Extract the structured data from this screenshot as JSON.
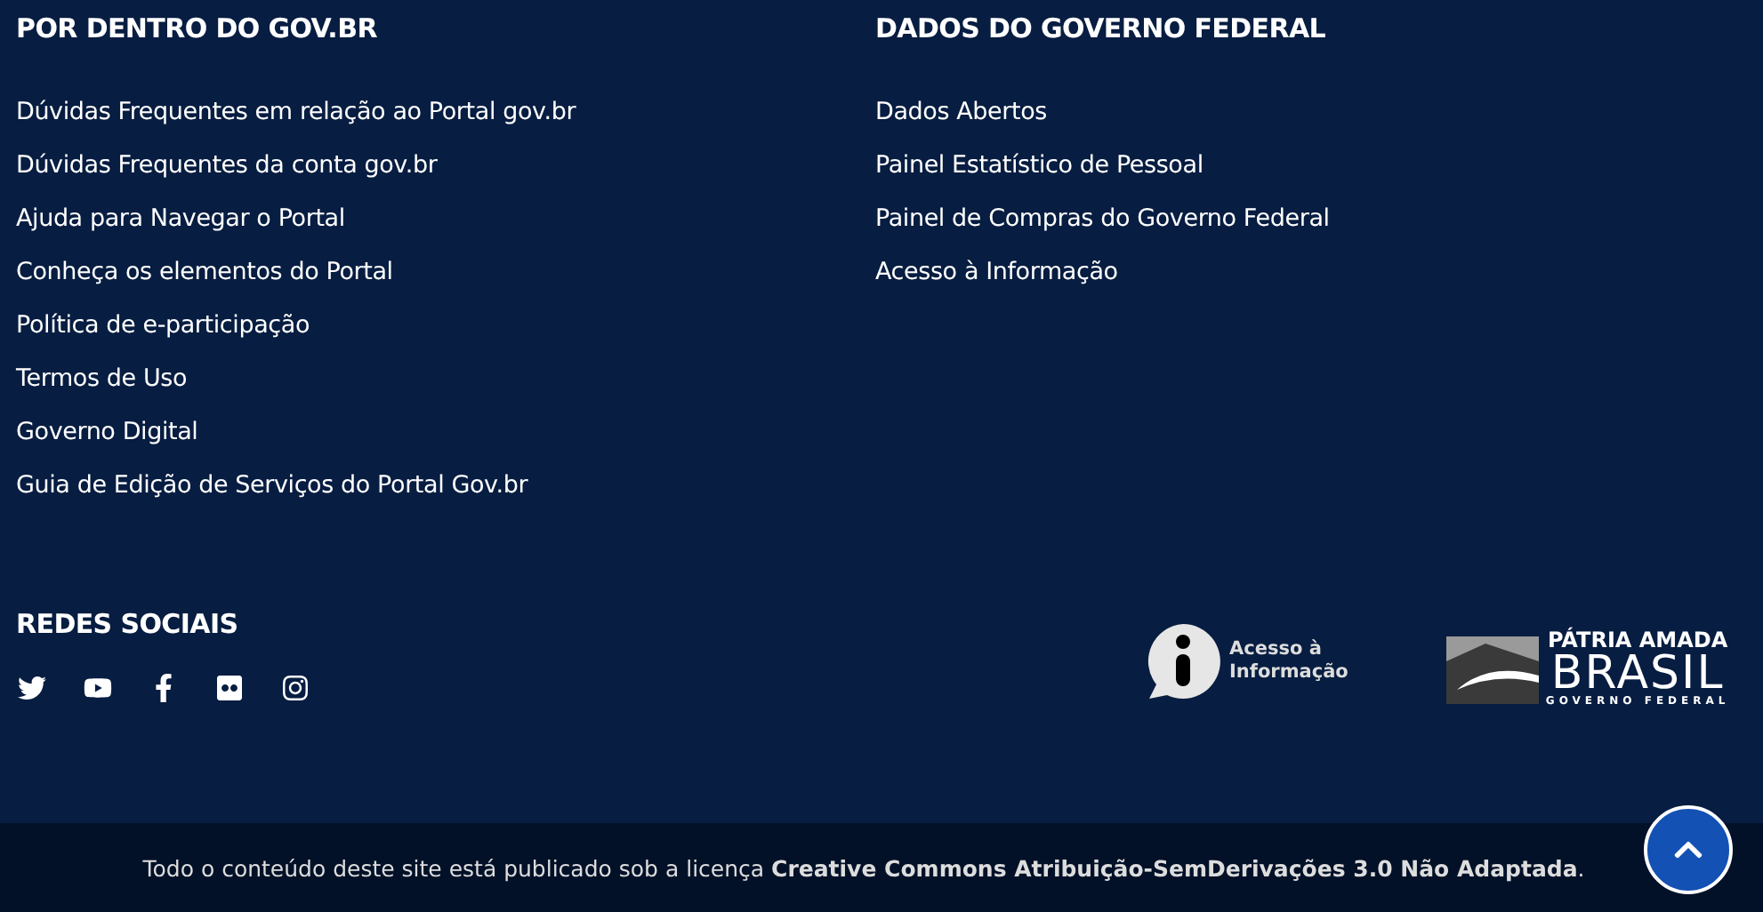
{
  "columns": [
    {
      "title": "POR DENTRO DO GOV.BR",
      "links": [
        "Dúvidas Frequentes em relação ao Portal gov.br",
        "Dúvidas Frequentes da conta gov.br",
        "Ajuda para Navegar o Portal",
        "Conheça os elementos do Portal",
        "Política de e-participação",
        "Termos de Uso",
        "Governo Digital",
        "Guia de Edição de Serviços do Portal Gov.br"
      ]
    },
    {
      "title": "DADOS DO GOVERNO FEDERAL",
      "links": [
        "Dados Abertos",
        "Painel Estatístico de Pessoal",
        "Painel de Compras do Governo Federal",
        "Acesso à Informação"
      ]
    }
  ],
  "social": {
    "title": "REDES SOCIAIS",
    "networks": [
      {
        "kind": "twitter"
      },
      {
        "kind": "youtube"
      },
      {
        "kind": "facebook"
      },
      {
        "kind": "flickr"
      },
      {
        "kind": "instagram"
      }
    ]
  },
  "access_info_logo": {
    "line_1": "Acesso à",
    "line_2": "Informação"
  },
  "brasil_logo": {
    "line_1": "PÁTRIA AMADA",
    "line_2": "BRASIL",
    "line_3": "GOVERNO FEDERAL"
  },
  "license": "Todo o conteúdo deste site está publicado sob a licença **Creative Commons Atribuição-SemDerivações 3.0 Não Adaptada**."
}
